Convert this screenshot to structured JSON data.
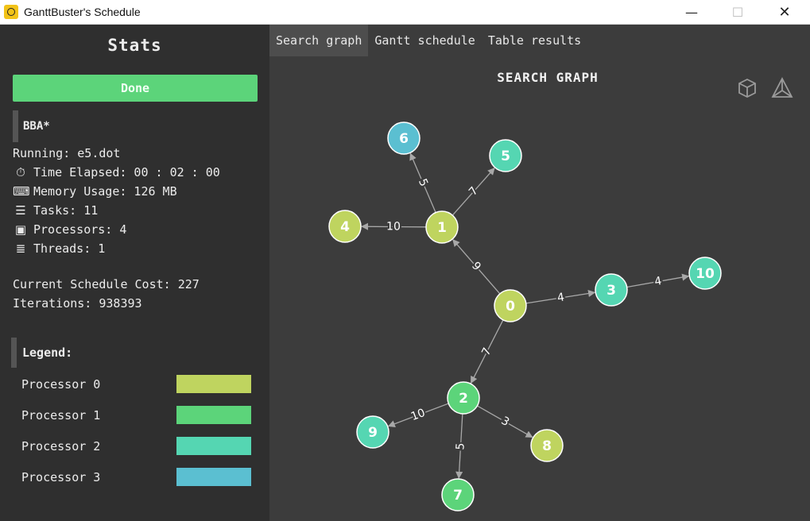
{
  "window": {
    "title": "GanttBuster's Schedule",
    "minimize": "—",
    "maximize": "☐",
    "close": "✕"
  },
  "sidebar": {
    "title": "Stats",
    "status_button": "Done",
    "algorithm": "BBA*",
    "running": "Running: e5.dot",
    "time_elapsed": "Time Elapsed: 00 : 02 : 00",
    "memory_usage": "Memory Usage: 126 MB",
    "tasks": "Tasks: 11",
    "processors": "Processors: 4",
    "threads": "Threads: 1",
    "schedule_cost": "Current Schedule Cost: 227",
    "iterations": "Iterations: 938393",
    "icons": {
      "time": "stopwatch-icon",
      "memory": "keyboard-icon",
      "tasks": "tasks-icon",
      "processors": "chip-icon",
      "threads": "spool-icon"
    },
    "legend_title": "Legend:",
    "legend": [
      {
        "label": "Processor 0",
        "color": "#bfd45f"
      },
      {
        "label": "Processor 1",
        "color": "#5cd47a"
      },
      {
        "label": "Processor 2",
        "color": "#55d6b2"
      },
      {
        "label": "Processor 3",
        "color": "#5bbfd1"
      }
    ]
  },
  "tabs": [
    {
      "label": "Search graph",
      "active": true
    },
    {
      "label": "Gantt schedule",
      "active": false
    },
    {
      "label": "Table results",
      "active": false
    }
  ],
  "graph": {
    "title": "SEARCH GRAPH",
    "nodes": [
      {
        "id": "0",
        "processor": 0
      },
      {
        "id": "1",
        "processor": 0
      },
      {
        "id": "2",
        "processor": 1
      },
      {
        "id": "3",
        "processor": 2
      },
      {
        "id": "4",
        "processor": 0
      },
      {
        "id": "5",
        "processor": 2
      },
      {
        "id": "6",
        "processor": 3
      },
      {
        "id": "7",
        "processor": 1
      },
      {
        "id": "8",
        "processor": 0
      },
      {
        "id": "9",
        "processor": 2
      },
      {
        "id": "10",
        "processor": 2
      }
    ],
    "edges": [
      {
        "from": "0",
        "to": "1",
        "weight": "9"
      },
      {
        "from": "0",
        "to": "3",
        "weight": "4"
      },
      {
        "from": "0",
        "to": "2",
        "weight": "7"
      },
      {
        "from": "1",
        "to": "6",
        "weight": "5"
      },
      {
        "from": "1",
        "to": "5",
        "weight": "7"
      },
      {
        "from": "1",
        "to": "4",
        "weight": "10"
      },
      {
        "from": "3",
        "to": "10",
        "weight": "4"
      },
      {
        "from": "2",
        "to": "9",
        "weight": "10"
      },
      {
        "from": "2",
        "to": "7",
        "weight": "5"
      },
      {
        "from": "2",
        "to": "8",
        "weight": "3"
      }
    ]
  }
}
